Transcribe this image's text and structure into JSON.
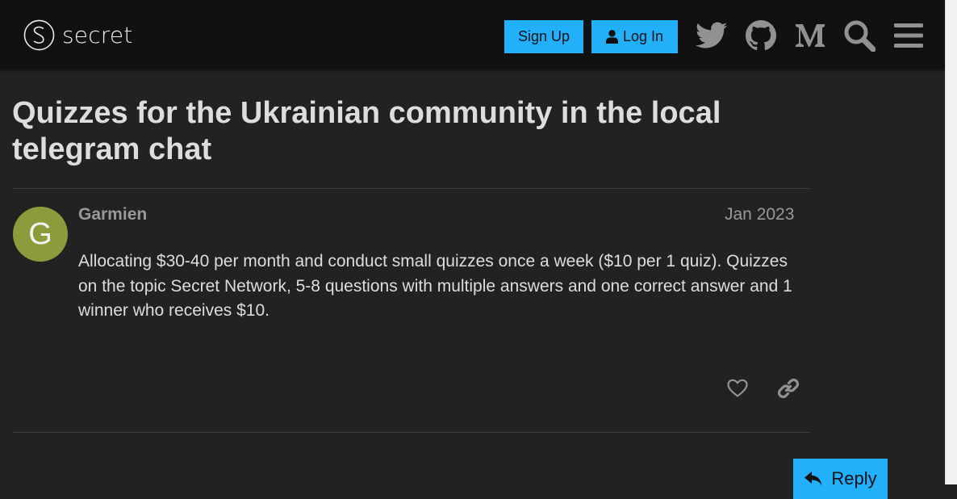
{
  "header": {
    "logo_text": "secret",
    "signup_label": "Sign Up",
    "login_label": "Log In",
    "icons": [
      "twitter-icon",
      "github-icon",
      "medium-icon",
      "search-icon",
      "menu-icon"
    ]
  },
  "topic": {
    "title": "Quizzes for the Ukrainian community in the local telegram chat"
  },
  "post": {
    "avatar_letter": "G",
    "avatar_color": "#8e9b3d",
    "username": "Garmien",
    "date": "Jan 2023",
    "body": "Allocating $30-40 per month and conduct small quizzes once a week ($10 per 1 quiz). Quizzes on the topic Secret Network, 5-8 questions with multiple answers and one correct answer and 1 winner who receives $10.",
    "actions": [
      "heart-icon",
      "link-icon"
    ]
  },
  "footer": {
    "reply_label": "Reply"
  },
  "colors": {
    "accent": "#23b0fb",
    "background": "#222222",
    "header_background": "#111111"
  }
}
